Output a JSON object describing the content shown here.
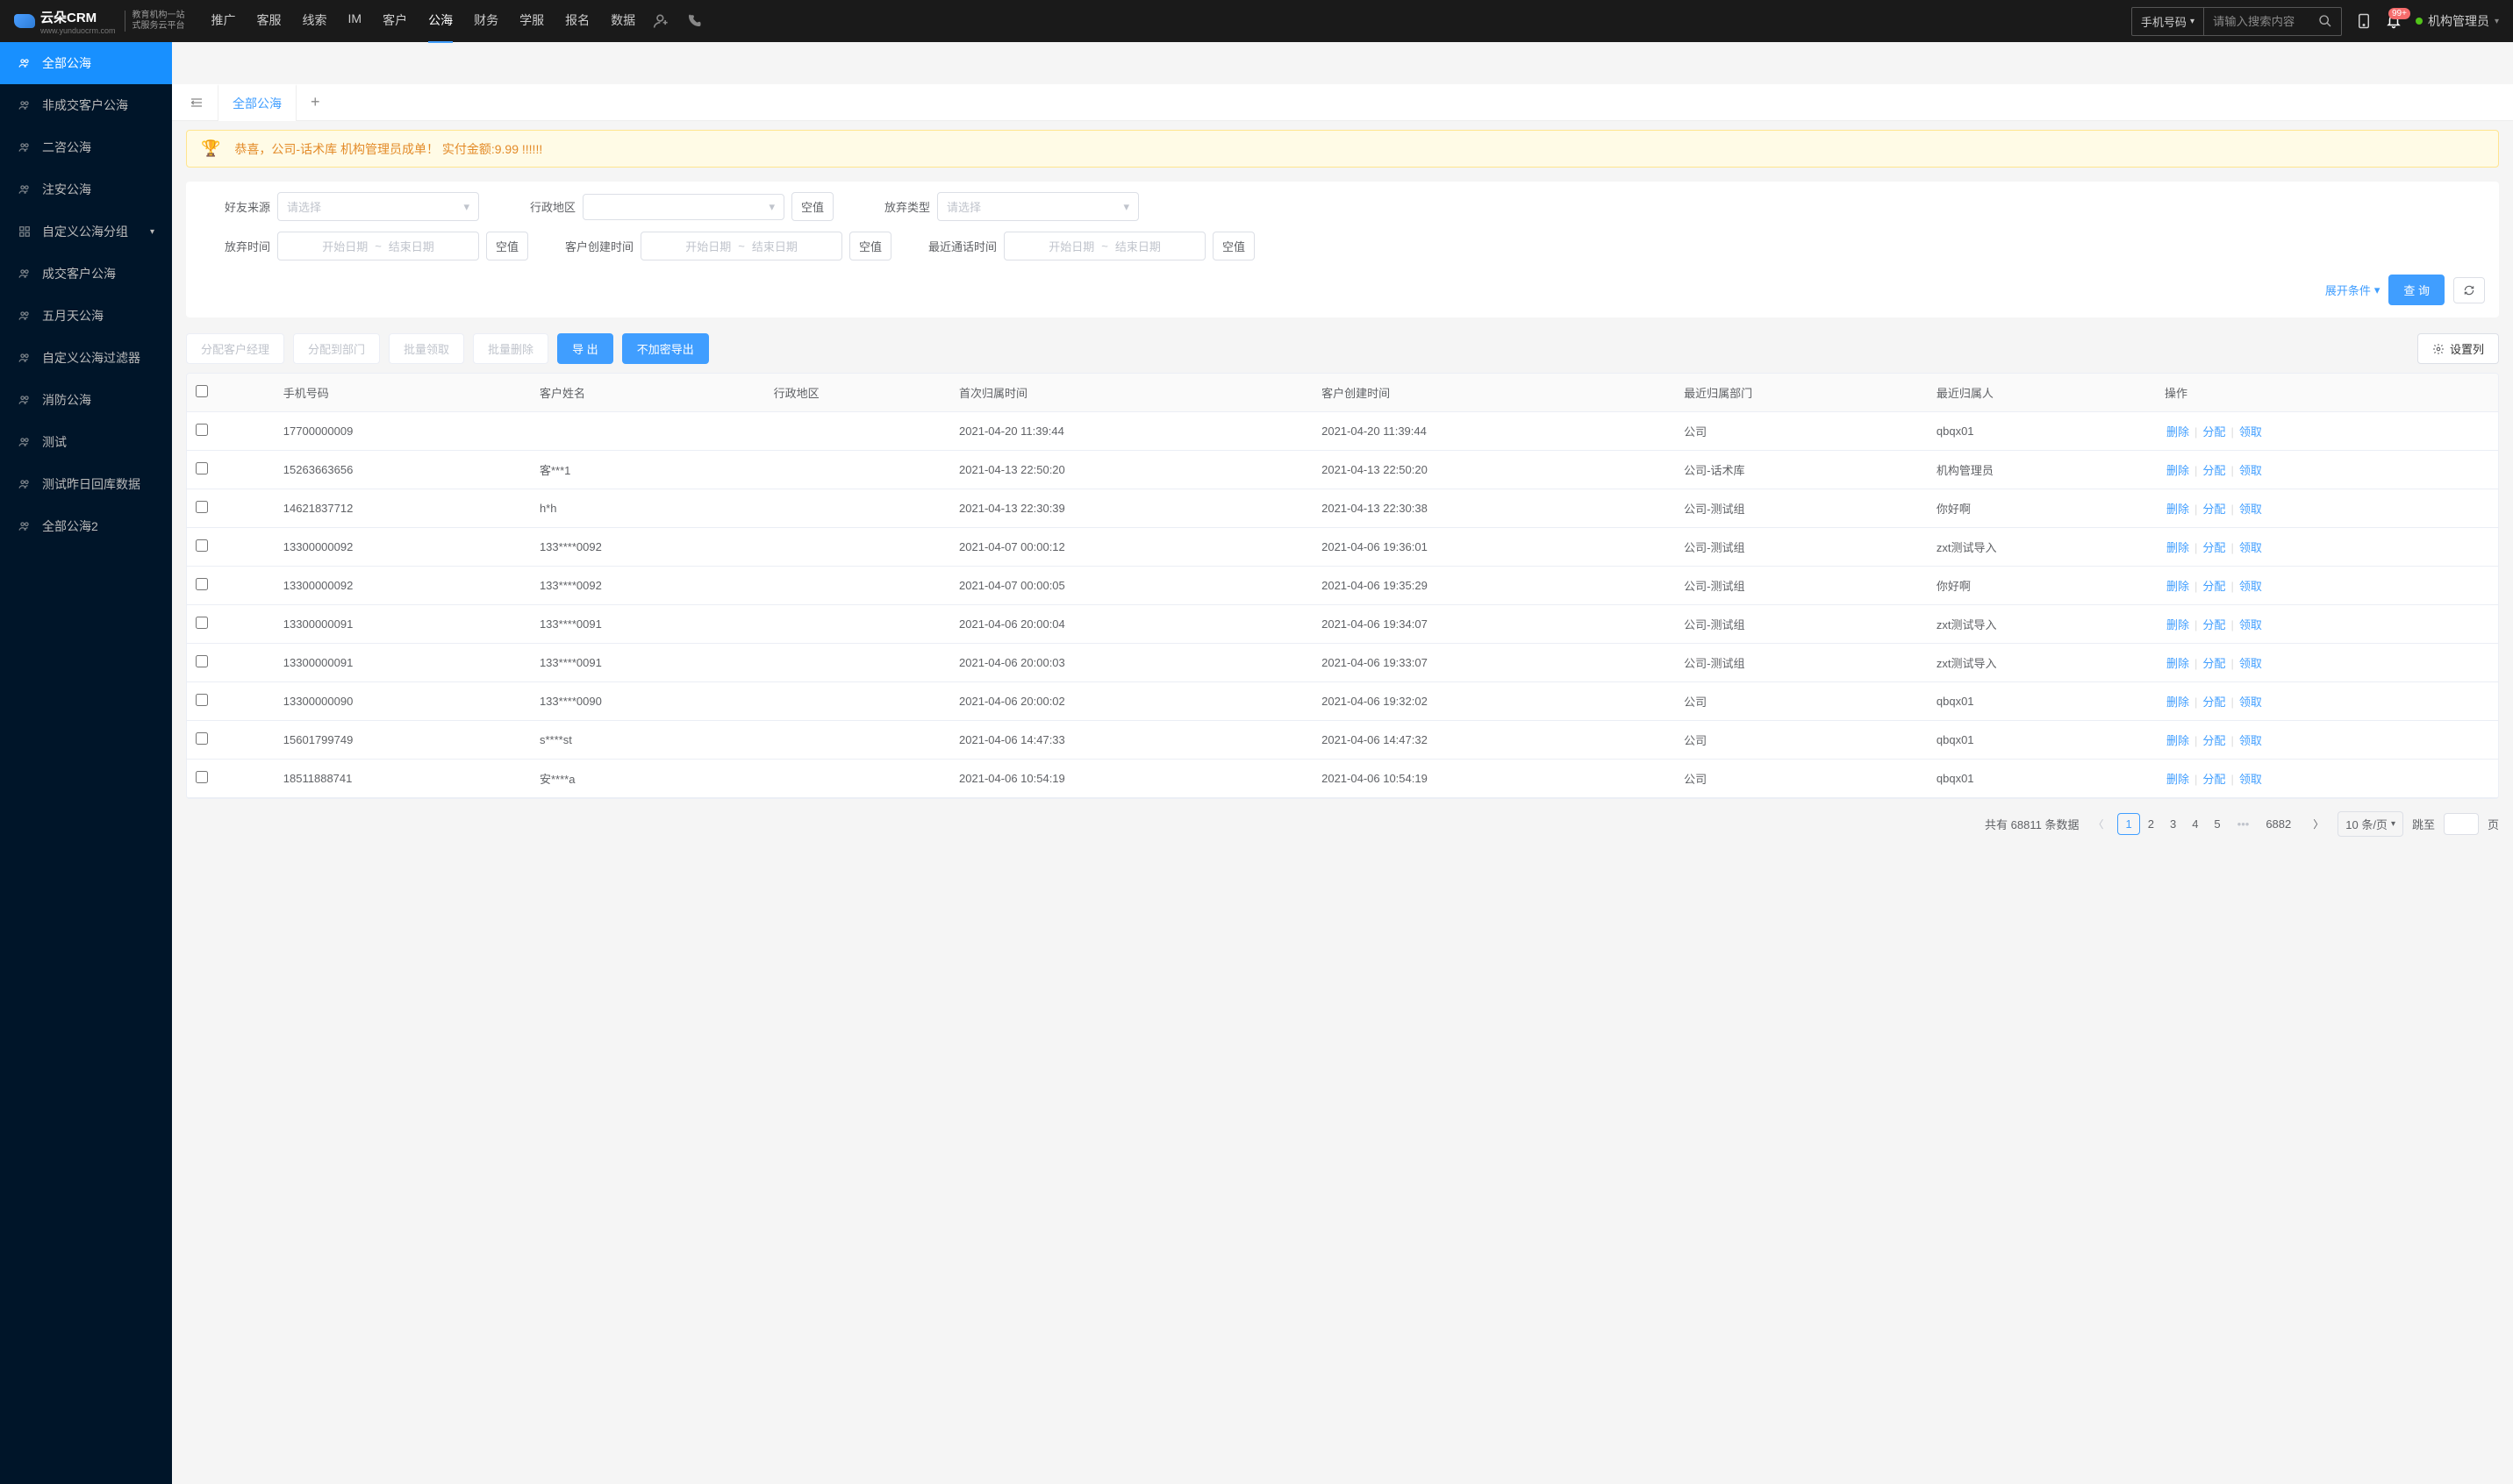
{
  "header": {
    "logo": "云朵CRM",
    "logo_url": "www.yunduocrm.com",
    "logo_sub1": "教育机构一站",
    "logo_sub2": "式服务云平台",
    "nav": [
      "推广",
      "客服",
      "线索",
      "IM",
      "客户",
      "公海",
      "财务",
      "学服",
      "报名",
      "数据"
    ],
    "nav_active": 5,
    "search_type": "手机号码",
    "search_placeholder": "请输入搜索内容",
    "badge": "99+",
    "user": "机构管理员"
  },
  "sidebar": [
    {
      "label": "全部公海",
      "active": true
    },
    {
      "label": "非成交客户公海"
    },
    {
      "label": "二咨公海"
    },
    {
      "label": "注安公海"
    },
    {
      "label": "自定义公海分组",
      "has_children": true
    },
    {
      "label": "成交客户公海"
    },
    {
      "label": "五月天公海"
    },
    {
      "label": "自定义公海过滤器"
    },
    {
      "label": "消防公海"
    },
    {
      "label": "测试"
    },
    {
      "label": "测试昨日回库数据"
    },
    {
      "label": "全部公海2"
    }
  ],
  "tab": {
    "label": "全部公海"
  },
  "banner": "恭喜，公司-话术库  机构管理员成单！  实付金额:9.99 !!!!!!",
  "filters": {
    "friend_source": {
      "label": "好友来源",
      "placeholder": "请选择"
    },
    "region": {
      "label": "行政地区"
    },
    "abandon_type": {
      "label": "放弃类型",
      "placeholder": "请选择"
    },
    "abandon_time": {
      "label": "放弃时间"
    },
    "create_time": {
      "label": "客户创建时间"
    },
    "last_call": {
      "label": "最近通话时间"
    },
    "start_ph": "开始日期",
    "end_ph": "结束日期",
    "empty": "空值",
    "expand": "展开条件",
    "query": "查 询"
  },
  "toolbar": {
    "assign_mgr": "分配客户经理",
    "assign_dept": "分配到部门",
    "batch_claim": "批量领取",
    "batch_delete": "批量删除",
    "export": "导 出",
    "export_plain": "不加密导出",
    "columns": "设置列"
  },
  "columns": [
    "手机号码",
    "客户姓名",
    "行政地区",
    "首次归属时间",
    "客户创建时间",
    "最近归属部门",
    "最近归属人",
    "操作"
  ],
  "ops": {
    "delete": "删除",
    "assign": "分配",
    "claim": "领取"
  },
  "rows": [
    {
      "phone": "17700000009",
      "name": "",
      "region": "",
      "first": "2021-04-20 11:39:44",
      "created": "2021-04-20 11:39:44",
      "dept": "公司",
      "owner": "qbqx01"
    },
    {
      "phone": "15263663656",
      "name": "客***1",
      "region": "",
      "first": "2021-04-13 22:50:20",
      "created": "2021-04-13 22:50:20",
      "dept": "公司-话术库",
      "owner": "机构管理员"
    },
    {
      "phone": "14621837712",
      "name": "h*h",
      "region": "",
      "first": "2021-04-13 22:30:39",
      "created": "2021-04-13 22:30:38",
      "dept": "公司-测试组",
      "owner": "你好啊"
    },
    {
      "phone": "13300000092",
      "name": "133****0092",
      "region": "",
      "first": "2021-04-07 00:00:12",
      "created": "2021-04-06 19:36:01",
      "dept": "公司-测试组",
      "owner": "zxt测试导入"
    },
    {
      "phone": "13300000092",
      "name": "133****0092",
      "region": "",
      "first": "2021-04-07 00:00:05",
      "created": "2021-04-06 19:35:29",
      "dept": "公司-测试组",
      "owner": "你好啊"
    },
    {
      "phone": "13300000091",
      "name": "133****0091",
      "region": "",
      "first": "2021-04-06 20:00:04",
      "created": "2021-04-06 19:34:07",
      "dept": "公司-测试组",
      "owner": "zxt测试导入"
    },
    {
      "phone": "13300000091",
      "name": "133****0091",
      "region": "",
      "first": "2021-04-06 20:00:03",
      "created": "2021-04-06 19:33:07",
      "dept": "公司-测试组",
      "owner": "zxt测试导入"
    },
    {
      "phone": "13300000090",
      "name": "133****0090",
      "region": "",
      "first": "2021-04-06 20:00:02",
      "created": "2021-04-06 19:32:02",
      "dept": "公司",
      "owner": "qbqx01"
    },
    {
      "phone": "15601799749",
      "name": "s****st",
      "region": "",
      "first": "2021-04-06 14:47:33",
      "created": "2021-04-06 14:47:32",
      "dept": "公司",
      "owner": "qbqx01"
    },
    {
      "phone": "18511888741",
      "name": "安****a",
      "region": "",
      "first": "2021-04-06 10:54:19",
      "created": "2021-04-06 10:54:19",
      "dept": "公司",
      "owner": "qbqx01"
    }
  ],
  "pagination": {
    "total_prefix": "共有",
    "total": "68811",
    "total_suffix": "条数据",
    "pages": [
      "1",
      "2",
      "3",
      "4",
      "5"
    ],
    "last": "6882",
    "size": "10 条/页",
    "jump_label": "跳至",
    "jump_suffix": "页"
  }
}
